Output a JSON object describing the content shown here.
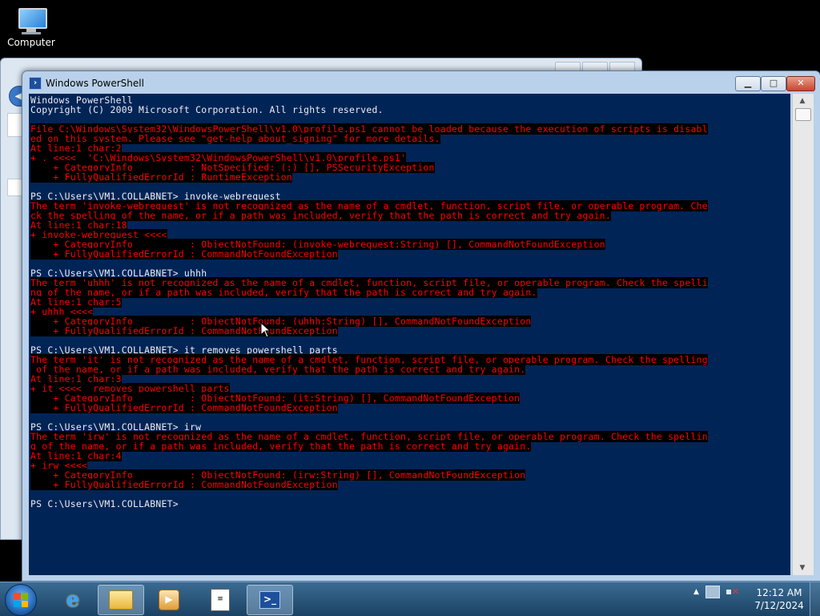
{
  "desktop": {
    "icons": [
      {
        "label": "Computer",
        "icon": "computer-icon"
      }
    ]
  },
  "window": {
    "title": "Windows PowerShell",
    "controls": {
      "minimize": "minimize-icon",
      "maximize": "maximize-icon",
      "close": "close-icon"
    }
  },
  "console": {
    "background": "#012456",
    "lines": [
      {
        "t": "Windows PowerShell",
        "err": false
      },
      {
        "t": "Copyright (C) 2009 Microsoft Corporation. All rights reserved.",
        "err": false
      },
      {
        "t": "",
        "err": false
      },
      {
        "t": "File C:\\Windows\\System32\\WindowsPowerShell\\v1.0\\profile.ps1 cannot be loaded because the execution of scripts is disabl",
        "err": true
      },
      {
        "t": "ed on this system. Please see \"get-help about_signing\" for more details.",
        "err": true
      },
      {
        "t": "At line:1 char:2",
        "err": true
      },
      {
        "t": "+ . <<<<  'C:\\Windows\\System32\\WindowsPowerShell\\v1.0\\profile.ps1'",
        "err": true
      },
      {
        "t": "    + CategoryInfo          : NotSpecified: (:) [], PSSecurityException",
        "err": true
      },
      {
        "t": "    + FullyQualifiedErrorId : RuntimeException",
        "err": true
      },
      {
        "t": "",
        "err": false
      },
      {
        "t": "PS C:\\Users\\VM1.COLLABNET> invoke-webrequest",
        "err": false
      },
      {
        "t": "The term 'invoke-webrequest' is not recognized as the name of a cmdlet, function, script file, or operable program. Che",
        "err": true
      },
      {
        "t": "ck the spelling of the name, or if a path was included, verify that the path is correct and try again.",
        "err": true
      },
      {
        "t": "At line:1 char:18",
        "err": true
      },
      {
        "t": "+ invoke-webrequest <<<<",
        "err": true
      },
      {
        "t": "    + CategoryInfo          : ObjectNotFound: (invoke-webrequest:String) [], CommandNotFoundException",
        "err": true
      },
      {
        "t": "    + FullyQualifiedErrorId : CommandNotFoundException",
        "err": true
      },
      {
        "t": "",
        "err": false
      },
      {
        "t": "PS C:\\Users\\VM1.COLLABNET> uhhh",
        "err": false
      },
      {
        "t": "The term 'uhhh' is not recognized as the name of a cmdlet, function, script file, or operable program. Check the spelli",
        "err": true
      },
      {
        "t": "ng of the name, or if a path was included, verify that the path is correct and try again.",
        "err": true
      },
      {
        "t": "At line:1 char:5",
        "err": true
      },
      {
        "t": "+ uhhh <<<<",
        "err": true
      },
      {
        "t": "    + CategoryInfo          : ObjectNotFound: (uhhh:String) [], CommandNotFoundException",
        "err": true
      },
      {
        "t": "    + FullyQualifiedErrorId : CommandNotFoundException",
        "err": true
      },
      {
        "t": "",
        "err": false
      },
      {
        "t": "PS C:\\Users\\VM1.COLLABNET> it removes powershell parts",
        "err": false
      },
      {
        "t": "The term 'it' is not recognized as the name of a cmdlet, function, script file, or operable program. Check the spelling",
        "err": true
      },
      {
        "t": " of the name, or if a path was included, verify that the path is correct and try again.",
        "err": true
      },
      {
        "t": "At line:1 char:3",
        "err": true
      },
      {
        "t": "+ it <<<<  removes powershell parts",
        "err": true
      },
      {
        "t": "    + CategoryInfo          : ObjectNotFound: (it:String) [], CommandNotFoundException",
        "err": true
      },
      {
        "t": "    + FullyQualifiedErrorId : CommandNotFoundException",
        "err": true
      },
      {
        "t": "",
        "err": false
      },
      {
        "t": "PS C:\\Users\\VM1.COLLABNET> irw",
        "err": false
      },
      {
        "t": "The term 'irw' is not recognized as the name of a cmdlet, function, script file, or operable program. Check the spellin",
        "err": true
      },
      {
        "t": "g of the name, or if a path was included, verify that the path is correct and try again.",
        "err": true
      },
      {
        "t": "At line:1 char:4",
        "err": true
      },
      {
        "t": "+ irw <<<<",
        "err": true
      },
      {
        "t": "    + CategoryInfo          : ObjectNotFound: (irw:String) [], CommandNotFoundException",
        "err": true
      },
      {
        "t": "    + FullyQualifiedErrorId : CommandNotFoundException",
        "err": true
      },
      {
        "t": "",
        "err": false
      },
      {
        "t": "PS C:\\Users\\VM1.COLLABNET>",
        "err": false
      }
    ]
  },
  "taskbar": {
    "start": "windows-start-icon",
    "buttons": [
      {
        "name": "internet-explorer",
        "icon": "ie-icon",
        "glyph": "e"
      },
      {
        "name": "windows-explorer",
        "icon": "folder-icon"
      },
      {
        "name": "media-player",
        "icon": "media-player-icon",
        "glyph": "▶"
      },
      {
        "name": "notepad",
        "icon": "document-icon",
        "glyph": "≡"
      },
      {
        "name": "powershell",
        "icon": "powershell-icon",
        "glyph": ">_"
      }
    ],
    "clock": {
      "time": "12:12 AM",
      "date": "7/12/2024"
    },
    "tray": {
      "up_arrow": "▲"
    }
  }
}
